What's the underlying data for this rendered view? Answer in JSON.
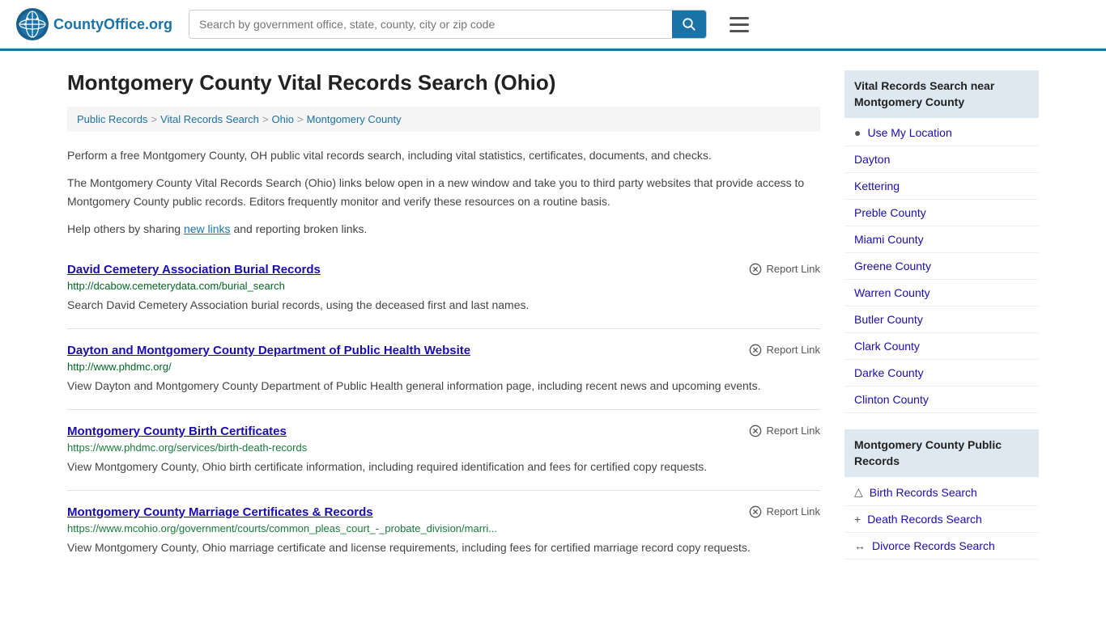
{
  "header": {
    "logo_text": "CountyOffice",
    "logo_tld": ".org",
    "search_placeholder": "Search by government office, state, county, city or zip code",
    "search_value": ""
  },
  "page": {
    "title": "Montgomery County Vital Records Search (Ohio)",
    "breadcrumb": [
      {
        "label": "Public Records",
        "href": "#"
      },
      {
        "label": "Vital Records Search",
        "href": "#"
      },
      {
        "label": "Ohio",
        "href": "#"
      },
      {
        "label": "Montgomery County",
        "href": "#"
      }
    ],
    "description_1": "Perform a free Montgomery County, OH public vital records search, including vital statistics, certificates, documents, and checks.",
    "description_2": "The Montgomery County Vital Records Search (Ohio) links below open in a new window and take you to third party websites that provide access to Montgomery County public records. Editors frequently monitor and verify these resources on a routine basis.",
    "description_3_pre": "Help others by sharing ",
    "description_3_link": "new links",
    "description_3_post": " and reporting broken links."
  },
  "records": [
    {
      "id": "david-cemetery",
      "title": "David Cemetery Association Burial Records",
      "url": "http://dcabow.cemeterydata.com/burial_search",
      "desc": "Search David Cemetery Association burial records, using the deceased first and last names.",
      "report_label": "Report Link"
    },
    {
      "id": "dayton-montgomery-health",
      "title": "Dayton and Montgomery County Department of Public Health Website",
      "url": "http://www.phdmc.org/",
      "desc": "View Dayton and Montgomery County Department of Public Health general information page, including recent news and upcoming events.",
      "report_label": "Report Link"
    },
    {
      "id": "birth-certificates",
      "title": "Montgomery County Birth Certificates",
      "url": "https://www.phdmc.org/services/birth-death-records",
      "desc": "View Montgomery County, Ohio birth certificate information, including required identification and fees for certified copy requests.",
      "report_label": "Report Link"
    },
    {
      "id": "marriage-certificates",
      "title": "Montgomery County Marriage Certificates & Records",
      "url": "https://www.mcohio.org/government/courts/common_pleas_court_-_probate_division/marri...",
      "desc": "View Montgomery County, Ohio marriage certificate and license requirements, including fees for certified marriage record copy requests.",
      "report_label": "Report Link"
    }
  ],
  "sidebar": {
    "nearby_header": "Vital Records Search near Montgomery County",
    "nearby_items": [
      {
        "label": "Use My Location",
        "icon": "location",
        "href": "#"
      },
      {
        "label": "Dayton",
        "icon": "",
        "href": "#"
      },
      {
        "label": "Kettering",
        "icon": "",
        "href": "#"
      },
      {
        "label": "Preble County",
        "icon": "",
        "href": "#"
      },
      {
        "label": "Miami County",
        "icon": "",
        "href": "#"
      },
      {
        "label": "Greene County",
        "icon": "",
        "href": "#"
      },
      {
        "label": "Warren County",
        "icon": "",
        "href": "#"
      },
      {
        "label": "Butler County",
        "icon": "",
        "href": "#"
      },
      {
        "label": "Clark County",
        "icon": "",
        "href": "#"
      },
      {
        "label": "Darke County",
        "icon": "",
        "href": "#"
      },
      {
        "label": "Clinton County",
        "icon": "",
        "href": "#"
      }
    ],
    "public_records_header": "Montgomery County Public Records",
    "public_records_items": [
      {
        "label": "Birth Records Search",
        "icon": "person",
        "href": "#"
      },
      {
        "label": "Death Records Search",
        "icon": "cross",
        "href": "#"
      },
      {
        "label": "Divorce Records Search",
        "icon": "divorce",
        "href": "#"
      }
    ]
  }
}
